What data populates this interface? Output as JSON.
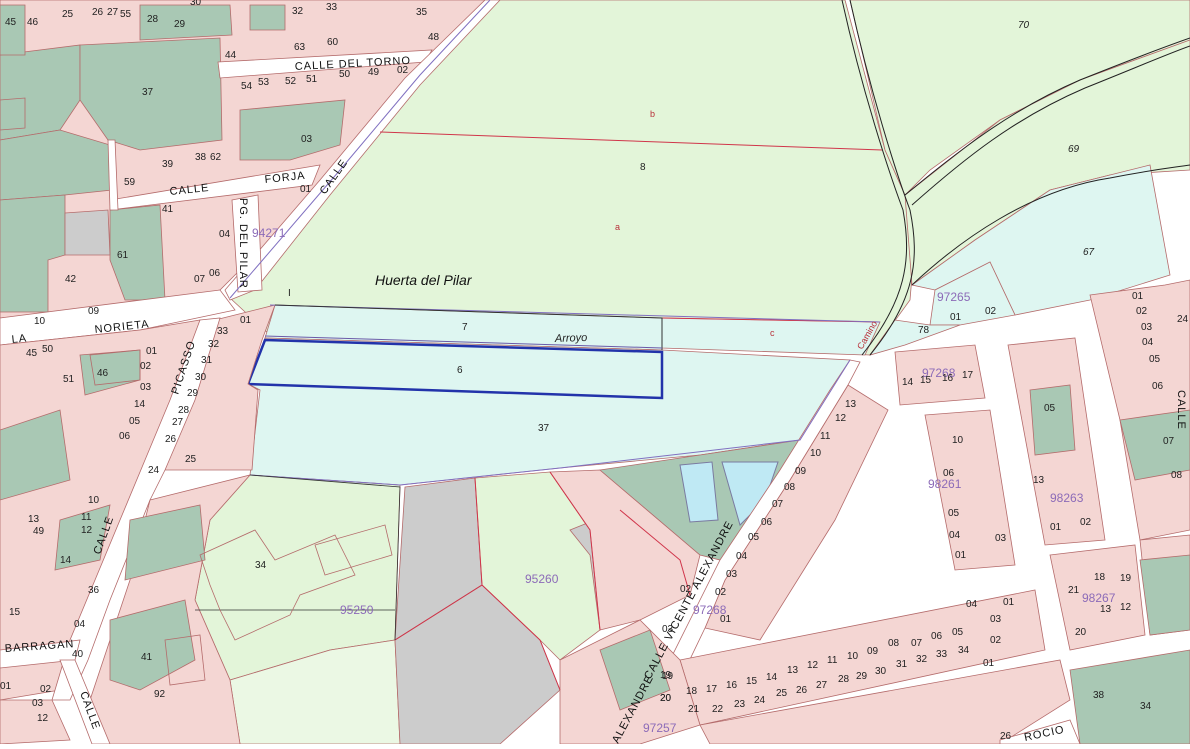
{
  "colors": {
    "urban_block": "#f4d6d3",
    "garden": "#a9c8b4",
    "rustic_light": "#e3f5d9",
    "parcel_teal": "#def6f1",
    "grey_area": "#cccccc",
    "street": "#ffffff",
    "boundary_purple": "#8070c0",
    "boundary_red": "#d0354a",
    "water": "#bfe9f4",
    "highlight": "#2233aa"
  },
  "labels": {
    "place_name": "Huerta del Pilar",
    "arroyo": "Arroyo",
    "camino": "Camino",
    "parcel_70": "70",
    "parcel_69": "69",
    "parcel_67": "67",
    "parcel_8": "8",
    "sub_a": "a",
    "sub_b": "b",
    "sub_c": "c",
    "parcel_7": "7",
    "parcel_6": "6",
    "parcel_37_center": "37",
    "parcel_78": "78",
    "parcel_34": "34",
    "roman_i": "I"
  },
  "streets": {
    "calle_del_torno": "CALLE  DEL  TORNO",
    "calle_forja_1": "CALLE",
    "calle_forja_2": "FORJA",
    "calle_diag": "CALLE",
    "pg_del_pilar": "PG. DEL PILAR",
    "norieta": "NORIETA",
    "la": "LA",
    "picasso": "PICASSO",
    "calle_left": "CALLE",
    "barragan": "BARRAGAN",
    "calle_bottom": "CALLE",
    "vicente_alexandre": "CALLE VICENTE ALEXANDRE",
    "alexandre_bottom": "ALEXANDRE",
    "calle_right": "CALLE",
    "rocio": "ROCIO"
  },
  "references": {
    "r94271": "94271",
    "r97265": "97265",
    "r97268a": "97268",
    "r98261": "98261",
    "r98263": "98263",
    "r98267": "98267",
    "r95250": "95250",
    "r95260": "95260",
    "r97268b": "97268",
    "r97257": "97257"
  },
  "parcel_numbers": {
    "topleft": [
      "45",
      "46",
      "25",
      "26",
      "27",
      "55",
      "28",
      "29",
      "30",
      "32",
      "33",
      "35",
      "48",
      "44",
      "63",
      "60",
      "37",
      "54",
      "53",
      "52",
      "51",
      "50",
      "49",
      "02",
      "03",
      "39",
      "38",
      "62",
      "59",
      "01",
      "41",
      "04",
      "61",
      "42",
      "07",
      "06",
      "09",
      "10"
    ],
    "leftmid": [
      "01",
      "33",
      "32",
      "31",
      "30",
      "29",
      "28",
      "27",
      "26",
      "25",
      "24",
      "01",
      "02",
      "03",
      "14",
      "05",
      "06",
      "46",
      "51",
      "45",
      "50",
      "10",
      "11",
      "12",
      "13",
      "49",
      "14",
      "15",
      "36",
      "04",
      "40",
      "41",
      "92",
      "01",
      "02",
      "03",
      "12"
    ],
    "rightblocks": [
      "01",
      "02",
      "03",
      "04",
      "05",
      "06",
      "07",
      "08",
      "24",
      "05",
      "13",
      "01",
      "02",
      "10",
      "06",
      "05",
      "04",
      "01",
      "03",
      "14",
      "15",
      "16",
      "17",
      "21",
      "18",
      "19",
      "20",
      "13",
      "12"
    ],
    "along_alexandre": [
      "13",
      "12",
      "11",
      "10",
      "09",
      "08",
      "07",
      "06",
      "05",
      "04",
      "03",
      "02",
      "01"
    ],
    "bottom_row1": [
      "18",
      "17",
      "16",
      "15",
      "14",
      "13",
      "12",
      "11",
      "10",
      "09",
      "08",
      "07",
      "06",
      "05",
      "04",
      "03",
      "02",
      "01"
    ],
    "bottom_row2": [
      "19",
      "20",
      "21",
      "22",
      "23",
      "24",
      "25",
      "26",
      "27",
      "28",
      "29",
      "30",
      "31",
      "32",
      "33",
      "34",
      "01"
    ],
    "small_top_right": [
      "01",
      "02"
    ],
    "bottom_right": [
      "38",
      "34",
      "26"
    ],
    "misc": [
      "03",
      "02",
      "19",
      "20"
    ]
  }
}
